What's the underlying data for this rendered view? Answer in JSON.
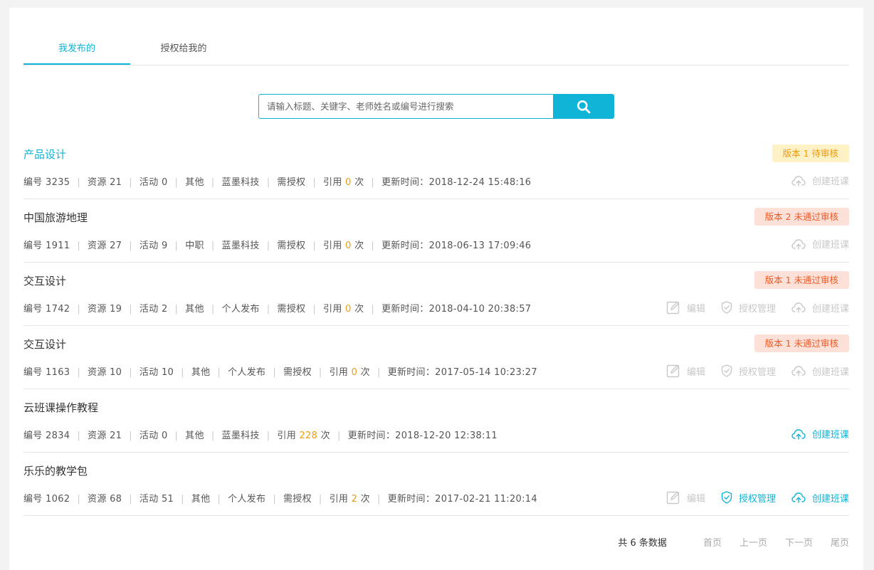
{
  "tabs": [
    {
      "label": "我发布的",
      "active": true
    },
    {
      "label": "授权给我的",
      "active": false
    }
  ],
  "search": {
    "placeholder": "请输入标题、关键字、老师姓名或编号进行搜索",
    "button_icon": "search-icon"
  },
  "meta_labels": {
    "id": "编号",
    "resources": "资源",
    "activities": "活动",
    "auth": "需授权",
    "cite_prefix": "引用",
    "cite_suffix": "次",
    "updated": "更新时间："
  },
  "action_labels": {
    "edit": "编辑",
    "auth_manage": "授权管理",
    "create_class": "创建班课"
  },
  "items": [
    {
      "title": "产品设计",
      "title_link": true,
      "badge": "版本 1 待审核",
      "badge_type": "pending",
      "id": "3235",
      "resources": "21",
      "activities": "0",
      "category": "其他",
      "publisher": "蓝墨科技",
      "needs_auth": true,
      "cites": "0",
      "updated": "2018-12-24 15:48:16",
      "actions": {
        "edit": null,
        "auth": null,
        "create": false
      }
    },
    {
      "title": "中国旅游地理",
      "title_link": false,
      "badge": "版本 2 未通过审核",
      "badge_type": "rejected",
      "id": "1911",
      "resources": "27",
      "activities": "9",
      "category": "中职",
      "publisher": "蓝墨科技",
      "needs_auth": true,
      "cites": "0",
      "updated": "2018-06-13 17:09:46",
      "actions": {
        "edit": null,
        "auth": null,
        "create": false
      }
    },
    {
      "title": "交互设计",
      "title_link": false,
      "badge": "版本 1 未通过审核",
      "badge_type": "rejected",
      "id": "1742",
      "resources": "19",
      "activities": "2",
      "category": "其他",
      "publisher": "个人发布",
      "needs_auth": true,
      "cites": "0",
      "updated": "2018-04-10 20:38:57",
      "actions": {
        "edit": false,
        "auth": false,
        "create": false
      }
    },
    {
      "title": "交互设计",
      "title_link": false,
      "badge": "版本 1 未通过审核",
      "badge_type": "rejected",
      "id": "1163",
      "resources": "10",
      "activities": "10",
      "category": "其他",
      "publisher": "个人发布",
      "needs_auth": true,
      "cites": "0",
      "updated": "2017-05-14 10:23:27",
      "actions": {
        "edit": false,
        "auth": false,
        "create": false
      }
    },
    {
      "title": "云班课操作教程",
      "title_link": false,
      "badge": null,
      "badge_type": null,
      "id": "2834",
      "resources": "21",
      "activities": "0",
      "category": "其他",
      "publisher": "蓝墨科技",
      "needs_auth": false,
      "cites": "228",
      "updated": "2018-12-20 12:38:11",
      "actions": {
        "edit": null,
        "auth": null,
        "create": true
      }
    },
    {
      "title": "乐乐的教学包",
      "title_link": false,
      "badge": null,
      "badge_type": null,
      "id": "1062",
      "resources": "68",
      "activities": "51",
      "category": "其他",
      "publisher": "个人发布",
      "needs_auth": true,
      "cites": "2",
      "updated": "2017-02-21 11:20:14",
      "actions": {
        "edit": false,
        "auth": true,
        "create": true
      }
    }
  ],
  "pagination": {
    "total": "共 6 条数据",
    "first": "首页",
    "prev": "上一页",
    "next": "下一页",
    "last": "尾页"
  },
  "colors": {
    "accent": "#0fb4d6",
    "orange": "#ef9b12",
    "rejected": "#ee5a24",
    "disabled": "#c8c8c8"
  }
}
